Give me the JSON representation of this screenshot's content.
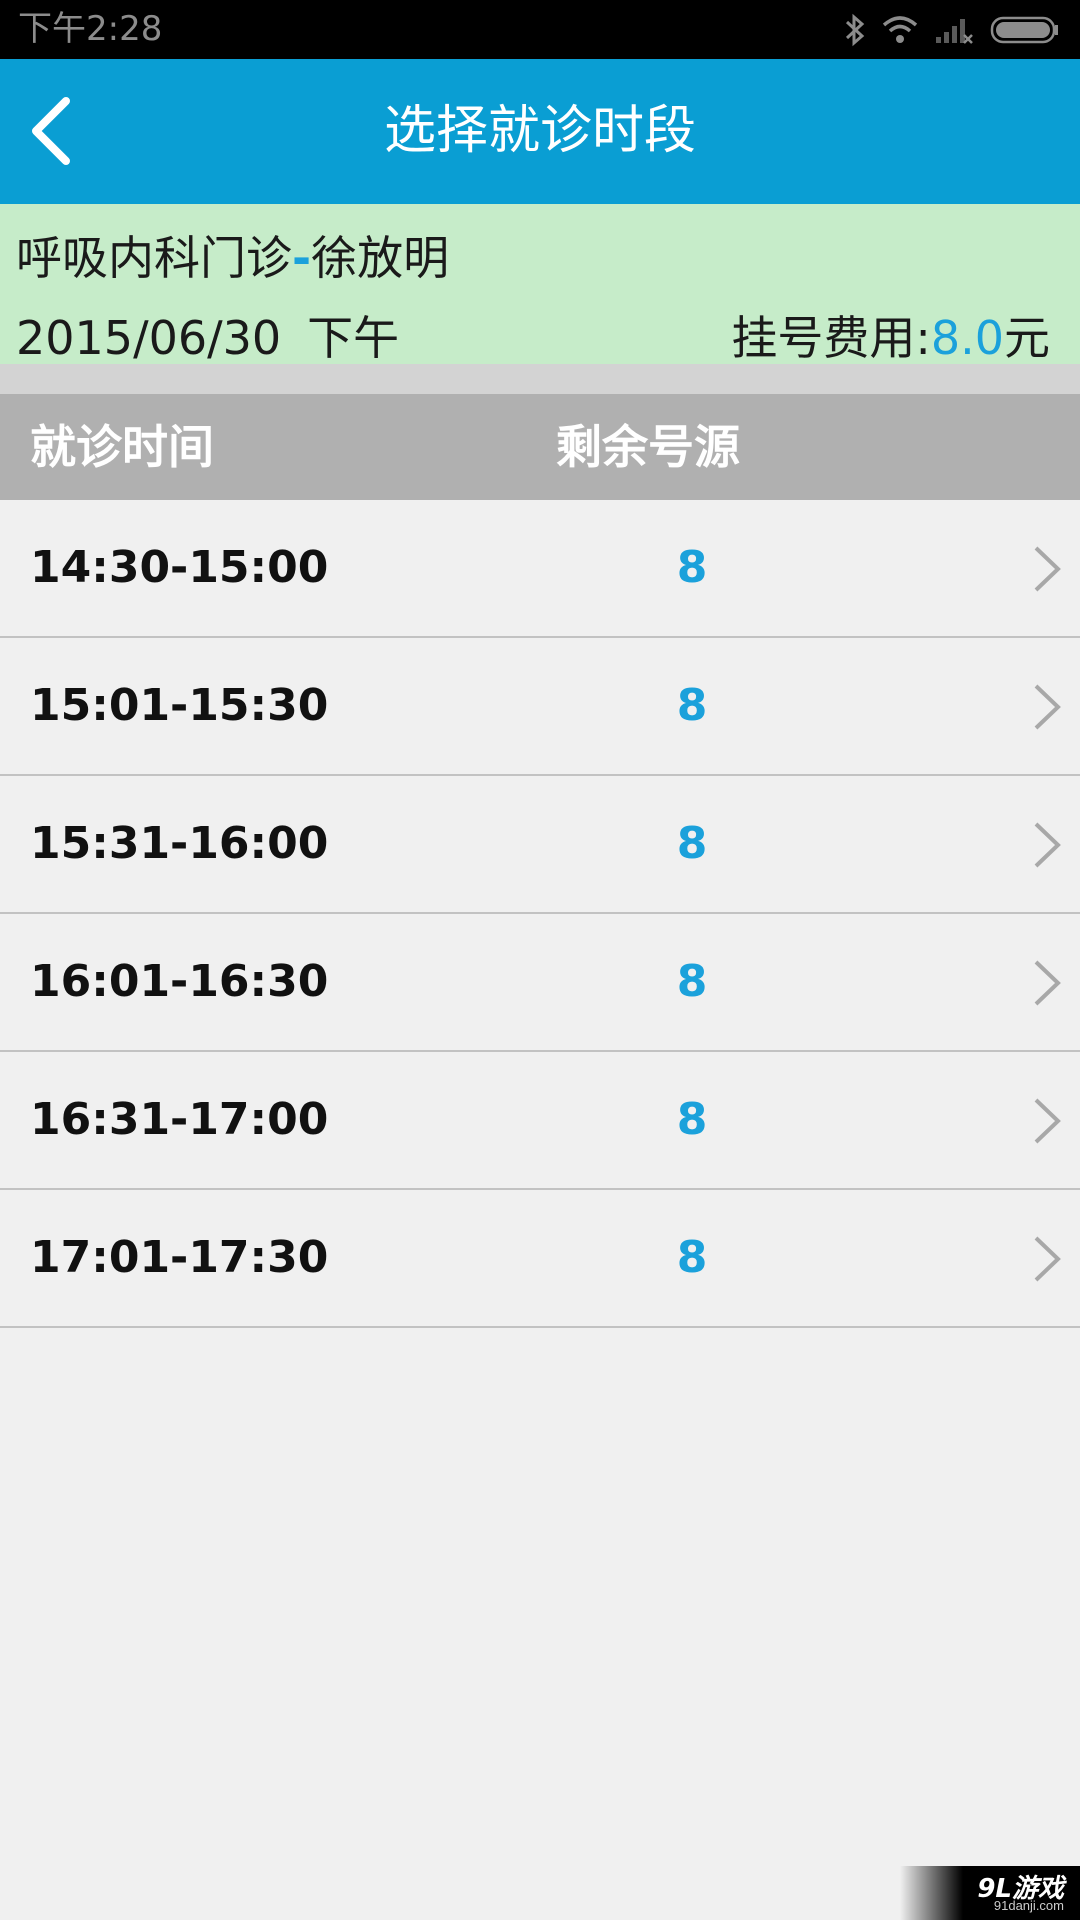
{
  "status_bar": {
    "time": "下午2:28",
    "icons": [
      "bluetooth-icon",
      "wifi-icon",
      "signal-icon",
      "battery-icon"
    ]
  },
  "header": {
    "title": "选择就诊时段",
    "back_icon": "chevron-left-icon",
    "background_color": "#0a9ed3"
  },
  "info": {
    "department": "呼吸内科门诊",
    "separator": "-",
    "doctor": "徐放明",
    "date": "2015/06/30",
    "period": "下午",
    "fee_label": "挂号费用:",
    "fee_value": "8.0",
    "fee_unit": "元",
    "background_color": "#c6ecc9",
    "accent_color": "#1ba1db"
  },
  "table": {
    "col_time": "就诊时间",
    "col_remaining": "剩余号源",
    "rows": [
      {
        "time": "14:30-15:00",
        "remaining": "8"
      },
      {
        "time": "15:01-15:30",
        "remaining": "8"
      },
      {
        "time": "15:31-16:00",
        "remaining": "8"
      },
      {
        "time": "16:01-16:30",
        "remaining": "8"
      },
      {
        "time": "16:31-17:00",
        "remaining": "8"
      },
      {
        "time": "17:01-17:30",
        "remaining": "8"
      }
    ],
    "row_icon": "chevron-right-icon"
  },
  "watermark": {
    "logo": "9L游戏",
    "domain": "91danji.com"
  }
}
